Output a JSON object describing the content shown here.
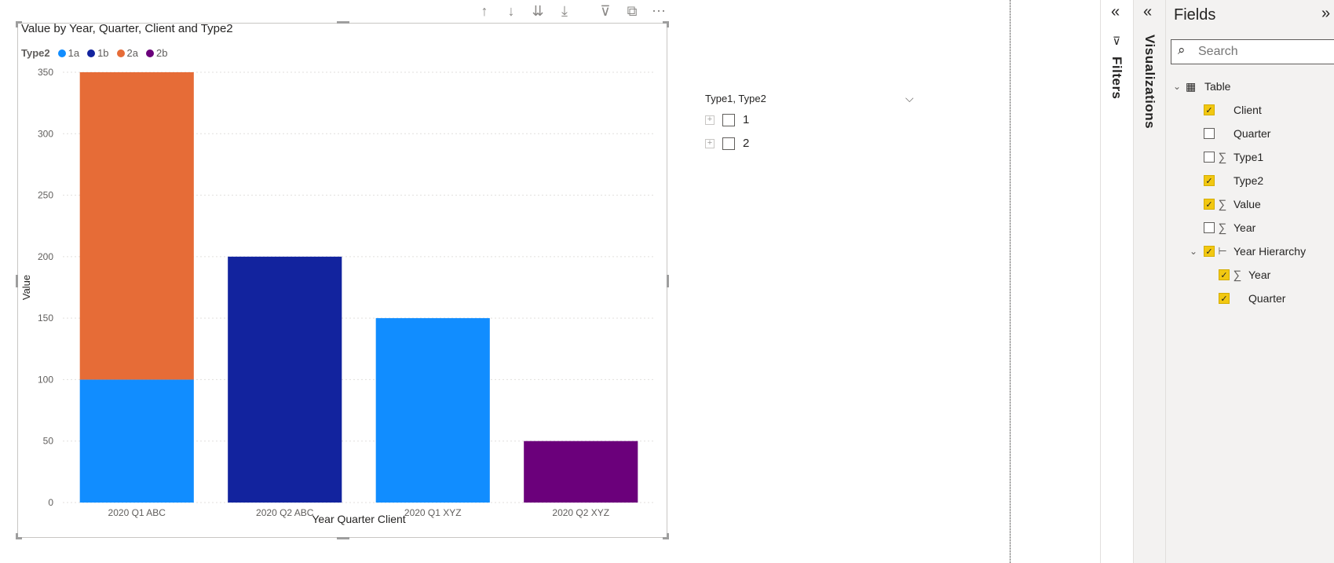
{
  "toolbar": {
    "icons": [
      "arrow-up-icon",
      "arrow-down-icon",
      "double-arrow-down-icon",
      "expand-hierarchy-icon",
      "filter-icon",
      "focus-mode-icon",
      "more-options-icon"
    ],
    "glyphs": [
      "↑",
      "↓",
      "⇊",
      "⤓",
      "⊽",
      "⧉",
      "⋯"
    ]
  },
  "chart_data": {
    "type": "bar",
    "stacked": true,
    "title": "Value by Year, Quarter, Client and Type2",
    "legend_title": "Type2",
    "legend_position": "top-left",
    "categories": [
      "2020 Q1 ABC",
      "2020 Q2 ABC",
      "2020 Q1 XYZ",
      "2020 Q2 XYZ"
    ],
    "series": [
      {
        "name": "1a",
        "color": "#118DFF",
        "values": [
          100,
          0,
          150,
          0
        ]
      },
      {
        "name": "1b",
        "color": "#12239E",
        "values": [
          0,
          200,
          0,
          0
        ]
      },
      {
        "name": "2a",
        "color": "#E66C37",
        "values": [
          250,
          0,
          0,
          0
        ]
      },
      {
        "name": "2b",
        "color": "#6B007B",
        "values": [
          0,
          0,
          0,
          50
        ]
      }
    ],
    "xlabel": "Year Quarter Client",
    "ylabel": "Value",
    "ylim": [
      0,
      350
    ],
    "yticks": [
      "0",
      "50",
      "100",
      "150",
      "200",
      "250",
      "300",
      "350"
    ],
    "grid": true
  },
  "slicer": {
    "header": "Type1, Type2",
    "items": [
      {
        "label": "1",
        "checked": false
      },
      {
        "label": "2",
        "checked": false
      }
    ]
  },
  "panes": {
    "filters_label": "Filters",
    "visualizations_label": "Visualizations",
    "fields_title": "Fields",
    "search_placeholder": "Search"
  },
  "fields": {
    "table_name": "Table",
    "items": [
      {
        "label": "Client",
        "checked": true,
        "sigma": false
      },
      {
        "label": "Quarter",
        "checked": false,
        "sigma": false
      },
      {
        "label": "Type1",
        "checked": false,
        "sigma": true
      },
      {
        "label": "Type2",
        "checked": true,
        "sigma": false
      },
      {
        "label": "Value",
        "checked": true,
        "sigma": true
      },
      {
        "label": "Year",
        "checked": false,
        "sigma": true
      }
    ],
    "hierarchy": {
      "label": "Year Hierarchy",
      "checked": true,
      "children": [
        {
          "label": "Year",
          "checked": true,
          "sigma": true
        },
        {
          "label": "Quarter",
          "checked": true,
          "sigma": false
        }
      ]
    }
  }
}
